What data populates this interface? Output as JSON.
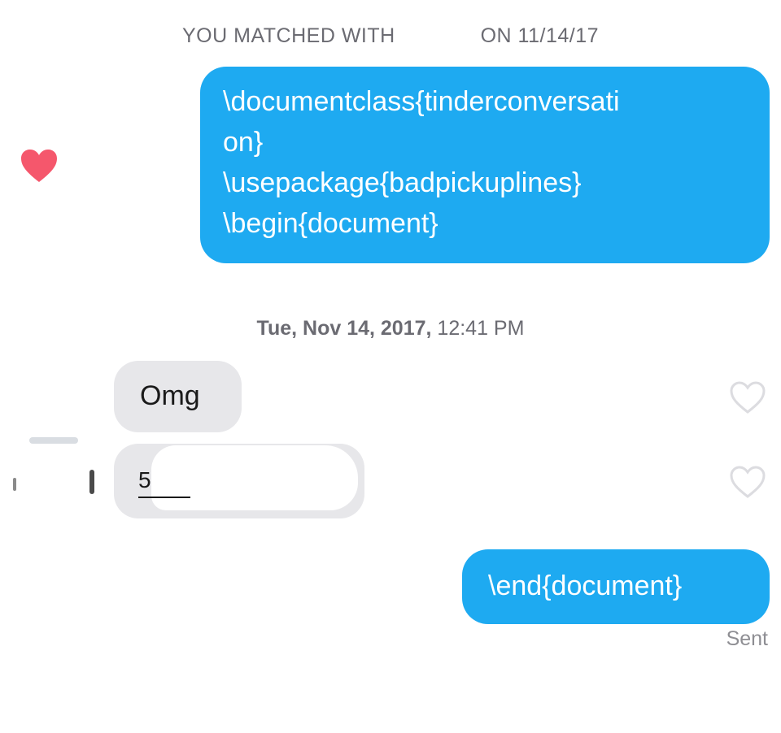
{
  "conversation": {
    "match_banner_left": "YOU MATCHED WITH",
    "match_banner_right": "ON 11/14/17",
    "messages": [
      {
        "direction": "sent",
        "text": "\\documentclass{tinderconversati\non}\n\\usepackage{badpickuplines}\n\\begin{document}",
        "liked": true
      },
      {
        "direction": "received",
        "text": "Omg"
      },
      {
        "direction": "received",
        "text": "5"
      },
      {
        "direction": "sent",
        "text": "\\end{document}"
      }
    ],
    "timestamp_day": "Tue, Nov 14, 2017,",
    "timestamp_time": "12:41 PM",
    "status": "Sent"
  },
  "colors": {
    "sent_bubble": "#1eaaf1",
    "received_bubble": "#e7e7ea",
    "like_heart": "#f5576c",
    "outline_heart": "#dcdce0",
    "meta_text": "#6b6b72"
  },
  "icons": {
    "like": "filled-heart-icon",
    "unliked": "outline-heart-icon"
  }
}
